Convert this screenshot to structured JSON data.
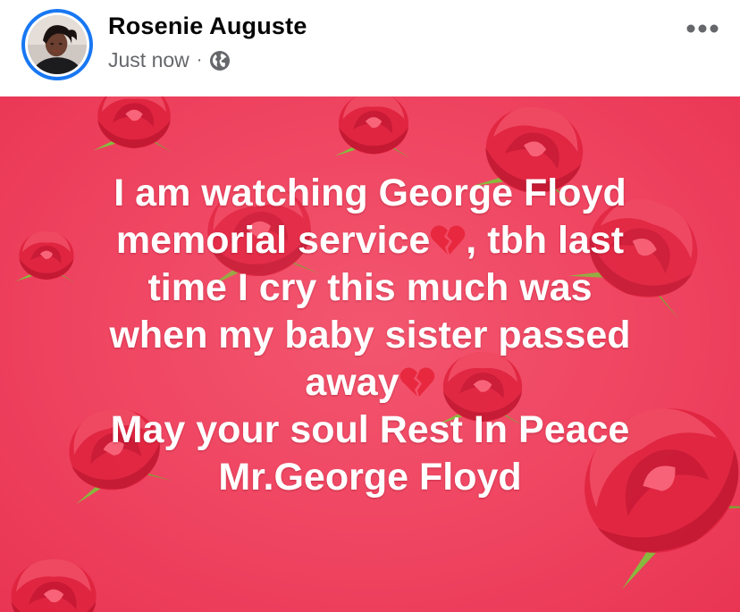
{
  "post": {
    "author": "Rosenie Auguste",
    "timestamp": "Just now",
    "separator": "·",
    "audience_icon": "globe-icon",
    "more_icon": "more-options-icon",
    "background_color": "#ef4461",
    "text_color": "#ffffff",
    "text_lines": [
      "I am watching George Floyd",
      "memorial service",
      ", tbh last",
      "time I cry this much was",
      "when my baby sister passed",
      "away",
      "May your soul Rest In Peace",
      "Mr.George Floyd"
    ],
    "emoji": "broken-heart-icon"
  }
}
